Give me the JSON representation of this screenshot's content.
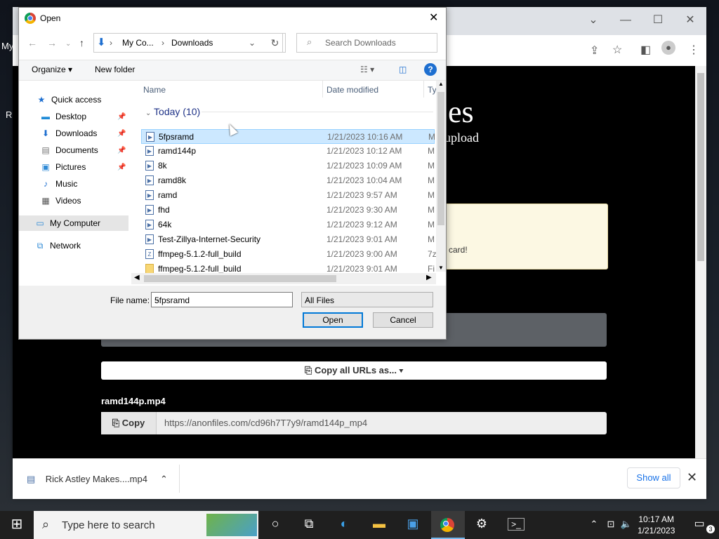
{
  "desktop": {
    "left_text_1": "My",
    "left_text_2": "Re"
  },
  "browser": {
    "site_title": "es",
    "site_subtitle": "upload",
    "notice_text": "card!",
    "copy_all_label": "Copy all URLs as...",
    "file_heading": "ramd144p.mp4",
    "copy_label": "Copy",
    "url_value": "https://anonfiles.com/cd96h7T7y9/ramd144p_mp4",
    "download_item": "Rick Astley Makes....mp4",
    "show_all": "Show all"
  },
  "dialog": {
    "title": "Open",
    "path": [
      "My Co...",
      "Downloads"
    ],
    "search_placeholder": "Search Downloads",
    "organize": "Organize",
    "new_folder": "New folder",
    "nav": {
      "quick_access": "Quick access",
      "items": [
        "Desktop",
        "Downloads",
        "Documents",
        "Pictures",
        "Music",
        "Videos"
      ],
      "my_computer": "My Computer",
      "network": "Network"
    },
    "columns": {
      "name": "Name",
      "date": "Date modified",
      "type": "Ty"
    },
    "group": "Today (10)",
    "files": [
      {
        "name": "5fpsramd",
        "date": "1/21/2023 10:16 AM",
        "type": "M"
      },
      {
        "name": "ramd144p",
        "date": "1/21/2023 10:12 AM",
        "type": "M"
      },
      {
        "name": "8k",
        "date": "1/21/2023 10:09 AM",
        "type": "M"
      },
      {
        "name": "ramd8k",
        "date": "1/21/2023 10:04 AM",
        "type": "M"
      },
      {
        "name": "ramd",
        "date": "1/21/2023 9:57 AM",
        "type": "M"
      },
      {
        "name": "fhd",
        "date": "1/21/2023 9:30 AM",
        "type": "M"
      },
      {
        "name": "64k",
        "date": "1/21/2023 9:12 AM",
        "type": "M"
      },
      {
        "name": "Test-Zillya-Internet-Security",
        "date": "1/21/2023 9:01 AM",
        "type": "M"
      },
      {
        "name": "ffmpeg-5.1.2-full_build",
        "date": "1/21/2023 9:00 AM",
        "type": "7z"
      },
      {
        "name": "ffmpeg-5.1.2-full_build",
        "date": "1/21/2023 9:01 AM",
        "type": "Fi"
      }
    ],
    "file_name_label": "File name:",
    "file_name_value": "5fpsramd",
    "file_type": "All Files",
    "open_btn": "Open",
    "cancel_btn": "Cancel"
  },
  "taskbar": {
    "search_placeholder": "Type here to search",
    "time": "10:17 AM",
    "date": "1/21/2023",
    "notif_count": "3"
  }
}
